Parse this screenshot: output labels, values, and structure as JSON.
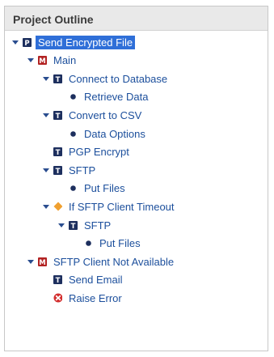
{
  "panel": {
    "title": "Project Outline"
  },
  "tree": [
    {
      "label": "Send Encrypted File",
      "depth": 0,
      "toggle": true,
      "icon": "project-icon",
      "color": "#1d2f5e",
      "glyph": "P",
      "selected": true
    },
    {
      "label": "Main",
      "depth": 1,
      "toggle": true,
      "icon": "module-icon",
      "color": "#b22222",
      "glyph": "M"
    },
    {
      "label": "Connect to Database",
      "depth": 2,
      "toggle": true,
      "icon": "task-icon",
      "color": "#1d2f5e",
      "glyph": "T"
    },
    {
      "label": "Retrieve Data",
      "depth": 3,
      "toggle": false,
      "icon": "bullet-icon",
      "color": "#1d2f5e"
    },
    {
      "label": "Convert to CSV",
      "depth": 2,
      "toggle": true,
      "icon": "task-icon",
      "color": "#1d2f5e",
      "glyph": "T"
    },
    {
      "label": "Data Options",
      "depth": 3,
      "toggle": false,
      "icon": "bullet-icon",
      "color": "#1d2f5e"
    },
    {
      "label": "PGP Encrypt",
      "depth": 2,
      "toggle": false,
      "icon": "task-icon",
      "color": "#1d2f5e",
      "glyph": "T"
    },
    {
      "label": "SFTP",
      "depth": 2,
      "toggle": true,
      "icon": "task-icon",
      "color": "#1d2f5e",
      "glyph": "T"
    },
    {
      "label": "Put Files",
      "depth": 3,
      "toggle": false,
      "icon": "bullet-icon",
      "color": "#1d2f5e"
    },
    {
      "label": "If SFTP Client Timeout",
      "depth": 2,
      "toggle": true,
      "icon": "condition-icon",
      "color": "#f0a030"
    },
    {
      "label": "SFTP",
      "depth": 3,
      "toggle": true,
      "icon": "task-icon",
      "color": "#1d2f5e",
      "glyph": "T"
    },
    {
      "label": "Put Files",
      "depth": 4,
      "toggle": false,
      "icon": "bullet-icon",
      "color": "#1d2f5e"
    },
    {
      "label": "SFTP Client Not Available",
      "depth": 1,
      "toggle": true,
      "icon": "module-icon",
      "color": "#b22222",
      "glyph": "M"
    },
    {
      "label": "Send Email",
      "depth": 2,
      "toggle": false,
      "icon": "task-icon",
      "color": "#1d2f5e",
      "glyph": "T"
    },
    {
      "label": "Raise Error",
      "depth": 2,
      "toggle": false,
      "icon": "error-icon",
      "color": "#d32f2f"
    }
  ]
}
